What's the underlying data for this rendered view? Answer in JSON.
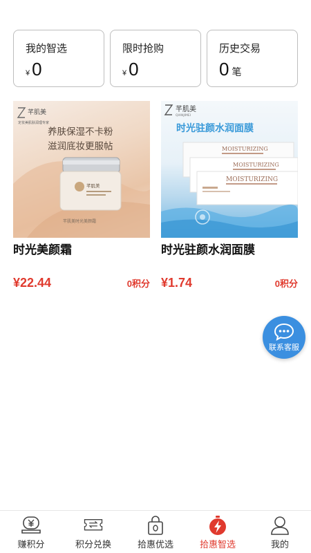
{
  "stats": [
    {
      "label": "我的智选",
      "currency": "¥",
      "value": "0",
      "unit": ""
    },
    {
      "label": "限时抢购",
      "currency": "¥",
      "value": "0",
      "unit": ""
    },
    {
      "label": "历史交易",
      "currency": "",
      "value": "0",
      "unit": "笔"
    }
  ],
  "products": [
    {
      "name": "时光美颜霜",
      "price": "¥22.44",
      "points": "0积分",
      "image": {
        "brand": "芊肌美",
        "tagline_small": "定妆美肌肤润理专家",
        "headline_1": "养肤保湿不卡粉",
        "headline_2": "滋润底妆更服帖",
        "jar_label": "芊肌美",
        "footer": "芊肌美时光美颜霜"
      }
    },
    {
      "name": "时光驻颜水润面膜",
      "price": "¥1.74",
      "points": "0积分",
      "image": {
        "brand": "芊肌美",
        "brand_en": "QIANJIMEI",
        "headline": "时光驻颜水润面膜",
        "pack_text_1": "MOISTURIZING",
        "pack_text_2": "MOISTURIZING",
        "pack_text_3": "MOISTURIZING"
      }
    }
  ],
  "fab": {
    "label": "联系客服",
    "icon": "chat-bubble-icon"
  },
  "tabs": [
    {
      "label": "赚积分",
      "icon": "yen-coin-icon",
      "active": false
    },
    {
      "label": "积分兑换",
      "icon": "exchange-ticket-icon",
      "active": false
    },
    {
      "label": "拾惠优选",
      "icon": "lock-bag-icon",
      "active": false
    },
    {
      "label": "拾惠智选",
      "icon": "lightning-timer-icon",
      "active": true
    },
    {
      "label": "我的",
      "icon": "person-icon",
      "active": false
    }
  ],
  "colors": {
    "accent": "#e03a2e",
    "fab": "#3b8fe0",
    "border": "#bdbdbd"
  }
}
